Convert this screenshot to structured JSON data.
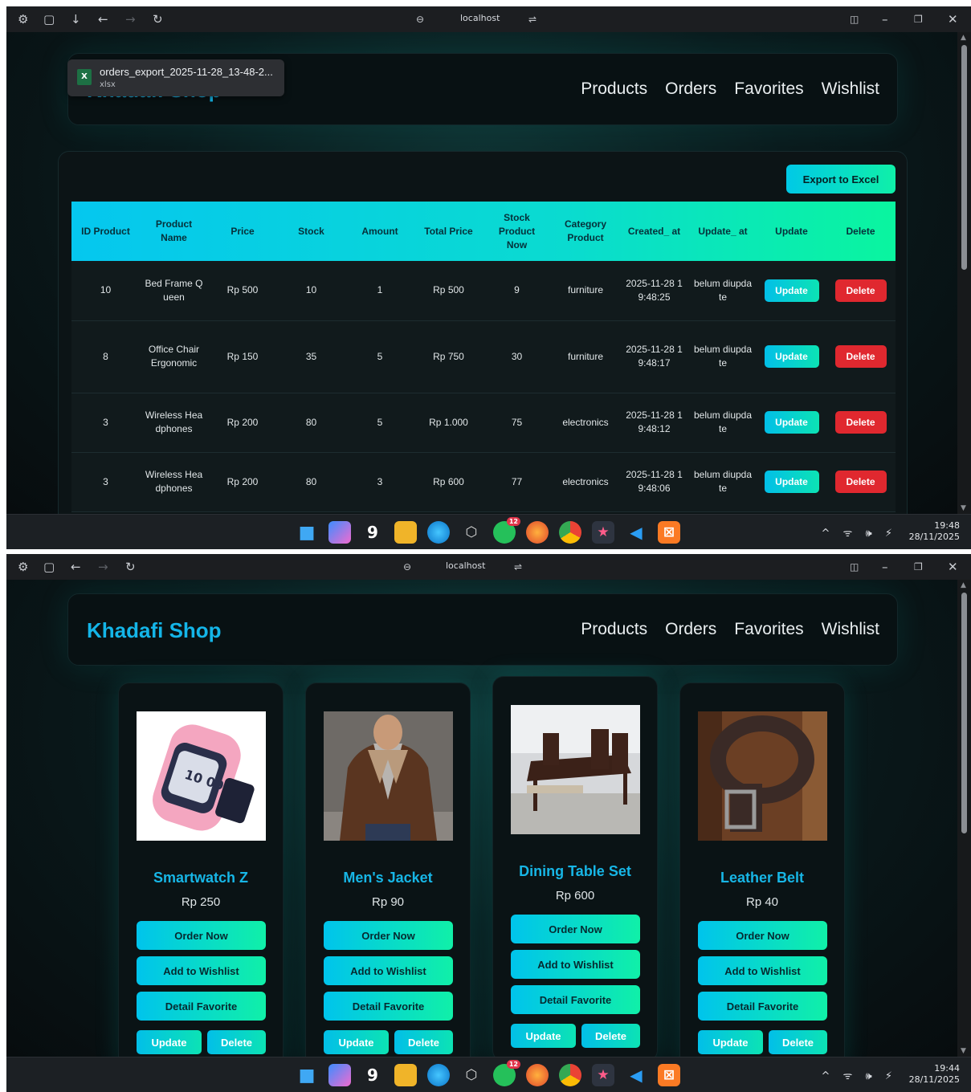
{
  "browser": {
    "url": "localhost",
    "icons": [
      "wrench-icon",
      "sidebar-icon",
      "download-icon",
      "back-icon",
      "forward-icon",
      "reload-icon"
    ]
  },
  "download": {
    "filename": "orders_export_2025-11-28_13-48-2...",
    "filetype": "xlsx",
    "badge": "X"
  },
  "brand": "Khadafi Shop",
  "nav": {
    "products": "Products",
    "orders": "Orders",
    "favorites": "Favorites",
    "wishlist": "Wishlist"
  },
  "orders": {
    "export_label": "Export to Excel",
    "headers": [
      "ID Product",
      "Product Name",
      "Price",
      "Stock",
      "Amount",
      "Total Price",
      "Stock Product Now",
      "Category Product",
      "Created_ at",
      "Update_ at",
      "Update",
      "Delete"
    ],
    "update_label": "Update",
    "delete_label": "Delete",
    "rows": [
      {
        "id": "10",
        "name": "Bed Frame Queen",
        "price": "Rp 500",
        "stock": "10",
        "amount": "1",
        "total": "Rp 500",
        "stock_now": "9",
        "category": "furniture",
        "created": "2025-11-28 19:48:25",
        "updated": "belum diupdate"
      },
      {
        "id": "8",
        "name": "Office Chair Ergonomic",
        "price": "Rp 150",
        "stock": "35",
        "amount": "5",
        "total": "Rp 750",
        "stock_now": "30",
        "category": "furniture",
        "created": "2025-11-28 19:48:17",
        "updated": "belum diupdate"
      },
      {
        "id": "3",
        "name": "Wireless Headphones",
        "price": "Rp 200",
        "stock": "80",
        "amount": "5",
        "total": "Rp 1.000",
        "stock_now": "75",
        "category": "electronics",
        "created": "2025-11-28 19:48:12",
        "updated": "belum diupdate"
      },
      {
        "id": "3",
        "name": "Wireless Headphones",
        "price": "Rp 200",
        "stock": "80",
        "amount": "3",
        "total": "Rp 600",
        "stock_now": "77",
        "category": "electronics",
        "created": "2025-11-28 19:48:06",
        "updated": "belum diupdate"
      }
    ]
  },
  "products": {
    "order_label": "Order Now",
    "wishlist_label": "Add to Wishlist",
    "favorite_label": "Detail Favorite",
    "update_label": "Update",
    "delete_label": "Delete",
    "items": [
      {
        "name": "Smartwatch Z",
        "price": "Rp 250",
        "watch_text": "10 09"
      },
      {
        "name": "Men's Jacket",
        "price": "Rp 90"
      },
      {
        "name": "Dining Table Set",
        "price": "Rp 600"
      },
      {
        "name": "Leather Belt",
        "price": "Rp 40"
      }
    ]
  },
  "taskbar": {
    "whatsapp_badge": "12",
    "tray": "^ ᯤ 🕪 ⚡",
    "screen1": {
      "time": "19:48",
      "date": "28/11/2025"
    },
    "screen2": {
      "time": "19:44",
      "date": "28/11/2025"
    },
    "icons": [
      "windows-start-icon",
      "copilot-icon",
      "9gag-icon",
      "file-explorer-icon",
      "edge-icon",
      "cube-app-icon",
      "whatsapp-icon",
      "firefox-icon",
      "chrome-icon",
      "star-app-icon",
      "vscode-icon",
      "xampp-icon"
    ]
  },
  "colors": {
    "accent": "#14b5e8",
    "gradient_start": "#00c9e6",
    "gradient_end": "#0ff0a8",
    "danger": "#e0282f"
  }
}
